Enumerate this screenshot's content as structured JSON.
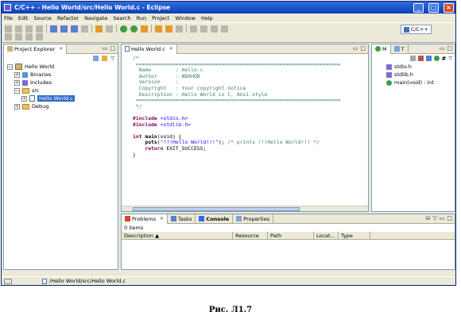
{
  "window": {
    "title": "C/C++ - Hello World/src/Hello World.c - Eclipse"
  },
  "menu": [
    "File",
    "Edit",
    "Source",
    "Refactor",
    "Navigate",
    "Search",
    "Run",
    "Project",
    "Window",
    "Help"
  ],
  "perspective": {
    "label": "C/C++"
  },
  "explorer": {
    "tab_label": "Project Explorer",
    "project": "Hello World",
    "items": [
      "Binaries",
      "Includes",
      "src",
      "Hello World.c",
      "Debug"
    ]
  },
  "editor": {
    "tab_label": "Hello World.c",
    "lines": {
      "l1": "/*",
      "l2": " ===================================================================",
      "l3": "  Name        : Hello.c",
      "l4": "  Author      : ИВАНОВ",
      "l5": "  Version     :",
      "l6": "  Copyright   : Your copyright notice",
      "l7": "  Description : Hello World in C, Ansi-style",
      "l8": " ===================================================================",
      "l9": " */",
      "inc1_kw": "#include",
      "inc1_file": " <stdio.h>",
      "inc2_kw": "#include",
      "inc2_file": " <stdlib.h>",
      "main_int": "int",
      "main_sig": " main",
      "main_rest": "(void) {",
      "puts_fn": "    puts",
      "puts_open": "(",
      "puts_str": "\"!!!Hello World!!!\"",
      "puts_close": ");",
      "puts_comment": " /* prints !!!Hello World!!! */",
      "ret_kw": "    return",
      "ret_rest": " EXIT_SUCCESS;",
      "close": "}"
    }
  },
  "outline": {
    "tab_m": "M",
    "tab_t": "T",
    "items": [
      "stdio.h",
      "stdlib.h",
      "main(void) : int"
    ]
  },
  "problems": {
    "tabs": [
      "Problems",
      "Tasks",
      "Console",
      "Properties"
    ],
    "count": "0 items",
    "columns": [
      "Description",
      "Resource",
      "Path",
      "Locat...",
      "Type"
    ]
  },
  "status": {
    "path": "/Hello World/src/Hello World.c"
  },
  "caption": "Рис. Л1.7"
}
